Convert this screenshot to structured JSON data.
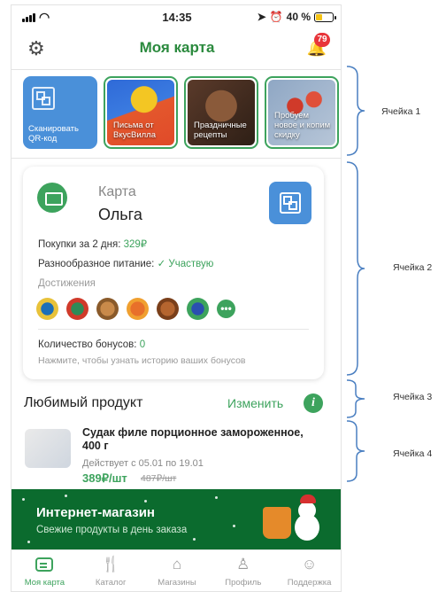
{
  "status_bar": {
    "time": "14:35",
    "battery": "40 %",
    "battery_level": 0.4
  },
  "header": {
    "title": "Моя карта",
    "notifications_count": "79"
  },
  "stories": [
    {
      "label": "Сканировать QR-код"
    },
    {
      "label": "Письма от ВкусВилла"
    },
    {
      "label": "Праздничные рецепты"
    },
    {
      "label": "Пробуем новое и копим скидку"
    }
  ],
  "card": {
    "type_label": "Карта",
    "owner_name": "Ольга",
    "purchases_label": "Покупки за 2 дня:",
    "purchases_value": "329₽",
    "diet_label": "Разнообразное питание:",
    "diet_value": "✓ Участвую",
    "achievements_label": "Достижения",
    "bonuses_label": "Количество бонусов:",
    "bonuses_value": "0",
    "bonuses_hint": "Нажмите, чтобы узнать историю ваших бонусов"
  },
  "favorite": {
    "title": "Любимый продукт",
    "change_label": "Изменить",
    "product_name": "Судак филе порционное замороженное, 400 г",
    "validity": "Действует с 05.01 по 19.01",
    "price": "389₽/шт",
    "old_price": "487₽/шт"
  },
  "banner": {
    "title": "Интернет-магазин",
    "subtitle": "Свежие продукты в день заказа"
  },
  "tabbar": [
    {
      "label": "Моя карта",
      "active": true
    },
    {
      "label": "Каталог",
      "active": false
    },
    {
      "label": "Магазины",
      "active": false
    },
    {
      "label": "Профиль",
      "active": false
    },
    {
      "label": "Поддержка",
      "active": false
    }
  ],
  "annotations": [
    {
      "label": "Ячейка 1"
    },
    {
      "label": "Ячейка 2"
    },
    {
      "label": "Ячейка 3"
    },
    {
      "label": "Ячейка 4"
    }
  ],
  "colors": {
    "brand_green": "#3da35d",
    "qr_blue": "#4a90d9",
    "banner_green": "#0b6b2e",
    "badge_red": "#e8353a"
  }
}
